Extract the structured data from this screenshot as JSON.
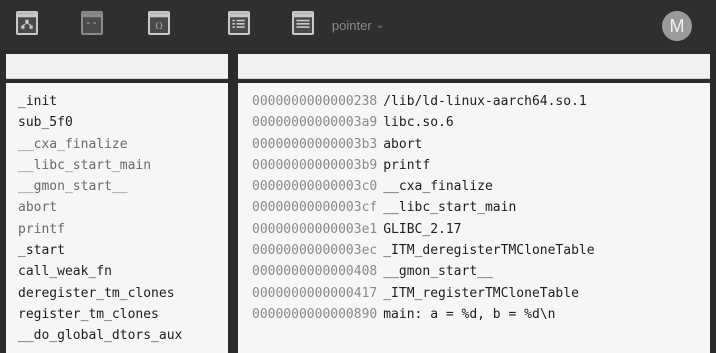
{
  "toolbar": {
    "icons": [
      "graph-view-icon",
      "hex-view-icon",
      "code-view-icon",
      "listing-view-icon",
      "strings-view-icon"
    ],
    "title": "pointer",
    "title_chevron": "⌄",
    "avatar_letter": "M"
  },
  "functions": {
    "items": [
      {
        "label": "_init",
        "dim": false
      },
      {
        "label": "sub_5f0",
        "dim": false
      },
      {
        "label": "__cxa_finalize",
        "dim": true
      },
      {
        "label": "__libc_start_main",
        "dim": true
      },
      {
        "label": "__gmon_start__",
        "dim": true
      },
      {
        "label": "abort",
        "dim": true
      },
      {
        "label": "printf",
        "dim": true
      },
      {
        "label": "_start",
        "dim": false
      },
      {
        "label": "call_weak_fn",
        "dim": false
      },
      {
        "label": "deregister_tm_clones",
        "dim": false
      },
      {
        "label": "register_tm_clones",
        "dim": false
      },
      {
        "label": "__do_global_dtors_aux",
        "dim": false
      }
    ]
  },
  "strings": {
    "items": [
      {
        "address": "0000000000000238",
        "value": "/lib/ld-linux-aarch64.so.1"
      },
      {
        "address": "00000000000003a9",
        "value": "libc.so.6"
      },
      {
        "address": "00000000000003b3",
        "value": "abort"
      },
      {
        "address": "00000000000003b9",
        "value": "printf"
      },
      {
        "address": "00000000000003c0",
        "value": "__cxa_finalize"
      },
      {
        "address": "00000000000003cf",
        "value": "__libc_start_main"
      },
      {
        "address": "00000000000003e1",
        "value": "GLIBC_2.17"
      },
      {
        "address": "00000000000003ec",
        "value": "_ITM_deregisterTMCloneTable"
      },
      {
        "address": "0000000000000408",
        "value": "__gmon_start__"
      },
      {
        "address": "0000000000000417",
        "value": "_ITM_registerTMCloneTable"
      },
      {
        "address": "0000000000000890",
        "value": "main: a = %d, b = %d\\n"
      }
    ]
  }
}
